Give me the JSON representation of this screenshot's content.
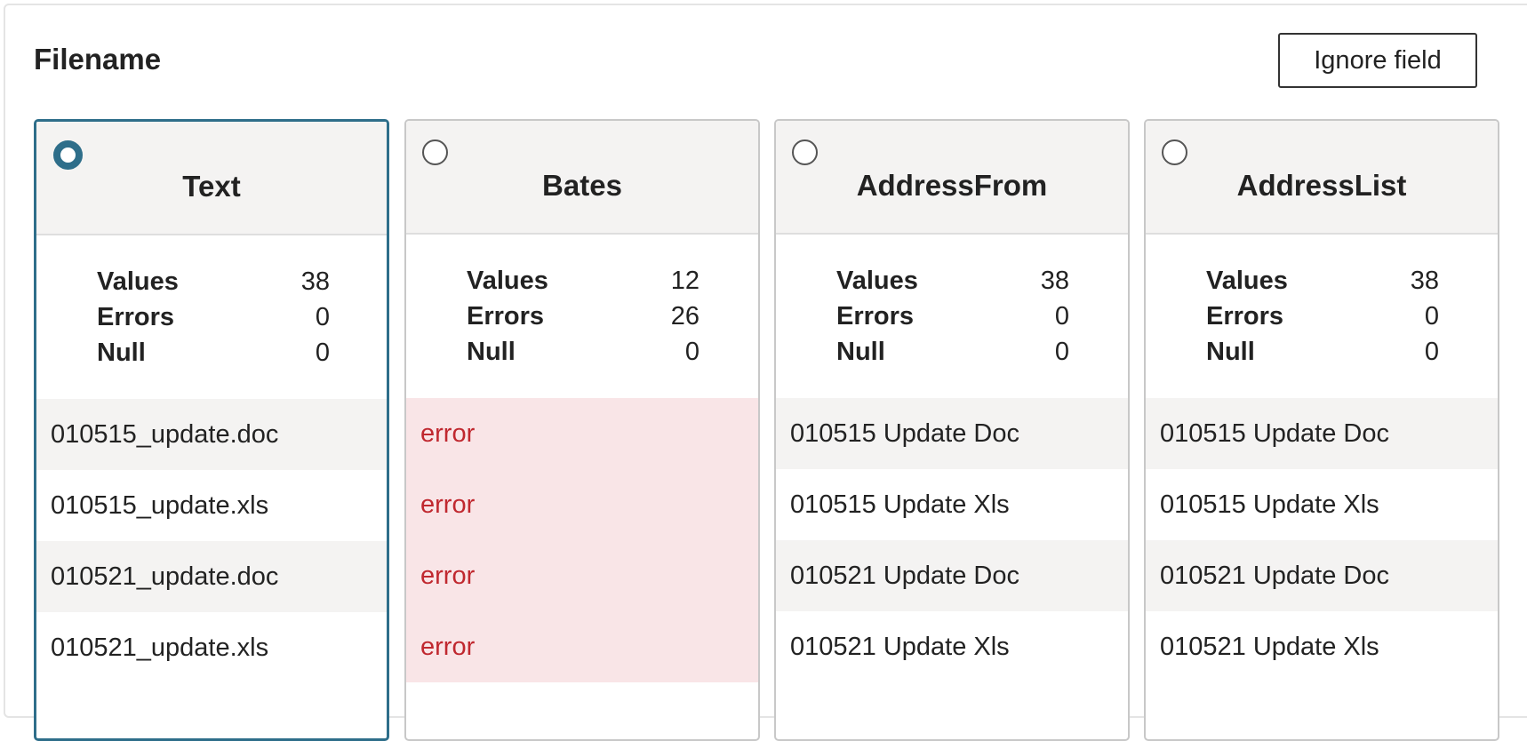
{
  "field": {
    "title": "Filename",
    "ignore_label": "Ignore field"
  },
  "colors": {
    "selected_border": "#2e6e8a",
    "error_text": "#c0282f",
    "error_background": "#f9e5e7",
    "header_background": "#f4f3f2"
  },
  "stat_labels": {
    "values": "Values",
    "errors": "Errors",
    "null": "Null"
  },
  "cards": [
    {
      "name": "Text",
      "selected": true,
      "stats": {
        "values": "38",
        "errors": "0",
        "null": "0"
      },
      "samples": [
        "010515_update.doc",
        "010515_update.xls",
        "010521_update.doc",
        "010521_update.xls"
      ]
    },
    {
      "name": "Bates",
      "selected": false,
      "stats": {
        "values": "12",
        "errors": "26",
        "null": "0"
      },
      "samples": [
        "error",
        "error",
        "error",
        "error"
      ]
    },
    {
      "name": "AddressFrom",
      "selected": false,
      "stats": {
        "values": "38",
        "errors": "0",
        "null": "0"
      },
      "samples": [
        "010515 Update Doc",
        "010515 Update Xls",
        "010521 Update Doc",
        "010521 Update Xls"
      ]
    },
    {
      "name": "AddressList",
      "selected": false,
      "stats": {
        "values": "38",
        "errors": "0",
        "null": "0"
      },
      "samples": [
        "010515 Update Doc",
        "010515 Update Xls",
        "010521 Update Doc",
        "010521 Update Xls"
      ]
    }
  ]
}
